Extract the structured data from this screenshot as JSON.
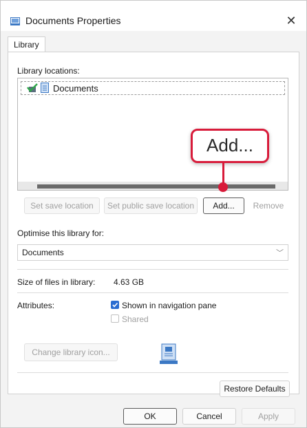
{
  "window": {
    "title": "Documents Properties",
    "close_glyph": "✕"
  },
  "tabs": [
    {
      "label": "Library"
    }
  ],
  "locations": {
    "label": "Library locations:",
    "items": [
      {
        "name": "Documents",
        "icon": "documents-library-icon",
        "status_icon": "green-check-icon"
      }
    ]
  },
  "location_buttons": {
    "set_save": "Set save location",
    "set_public_save": "Set public save location",
    "add": "Add...",
    "remove": "Remove"
  },
  "callout": {
    "text": "Add...",
    "accent_color": "#d81b3a"
  },
  "optimise": {
    "label": "Optimise this library for:",
    "value": "Documents"
  },
  "size": {
    "label": "Size of files in library:",
    "value": "4.63 GB"
  },
  "attributes": {
    "label": "Attributes:",
    "shown_in_nav": {
      "label": "Shown in navigation pane",
      "checked": true
    },
    "shared": {
      "label": "Shared",
      "checked": false
    }
  },
  "change_icon_button": "Change library icon...",
  "restore_defaults_button": "Restore Defaults",
  "footer": {
    "ok": "OK",
    "cancel": "Cancel",
    "apply": "Apply"
  },
  "colors": {
    "checkbox_accent": "#2a6cd1",
    "icon_blue": "#3b78c4"
  }
}
